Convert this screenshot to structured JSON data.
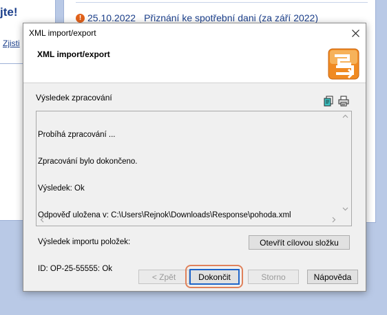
{
  "background": {
    "left_title": "jte!",
    "left_link": "Zjisti",
    "notice_date": "25.10.2022",
    "notice_title": "Přiznání ke spotřební dani (za září 2022)"
  },
  "dialog": {
    "window_title": "XML import/export",
    "header_title": "XML import/export",
    "result_label": "Výsledek zpracování",
    "log_lines": [
      "Probíhá zpracování ...",
      "Zpracování bylo dokončeno.",
      "Výsledek: Ok",
      "Odpověď uložena v: C:\\Users\\Rejnok\\Downloads\\Response\\pohoda.xml",
      "Výsledek importu položek:",
      "ID: OP-25-55555: Ok"
    ],
    "open_folder_label": "Otevřít cílovou složku",
    "buttons": {
      "back": "< Zpět",
      "finish": "Dokončit",
      "cancel": "Storno",
      "help": "Nápověda"
    }
  },
  "colors": {
    "accent_highlight": "#e0815a",
    "link_blue": "#1b3f8b",
    "warning_orange": "#e2621b"
  },
  "icons": [
    "warning-icon",
    "close-icon",
    "app-logo-icon",
    "copy-icon",
    "print-icon",
    "scroll-up-icon",
    "scroll-down-icon",
    "scroll-left-icon",
    "scroll-right-icon"
  ]
}
